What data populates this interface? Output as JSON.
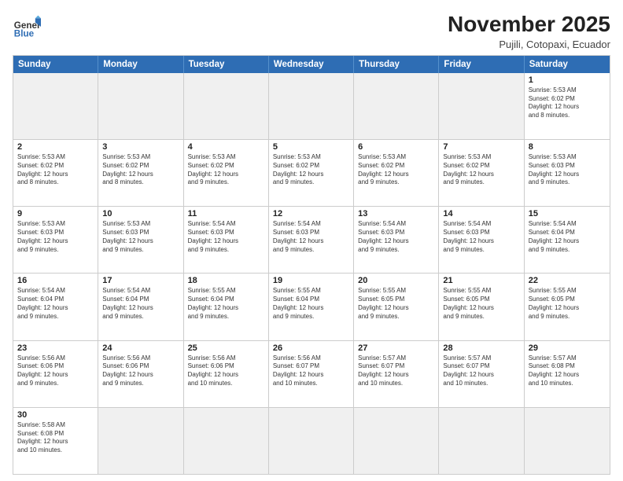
{
  "logo": {
    "line1": "General",
    "line2": "Blue"
  },
  "title": "November 2025",
  "subtitle": "Pujili, Cotopaxi, Ecuador",
  "days_of_week": [
    "Sunday",
    "Monday",
    "Tuesday",
    "Wednesday",
    "Thursday",
    "Friday",
    "Saturday"
  ],
  "weeks": [
    [
      {
        "day": "",
        "empty": true
      },
      {
        "day": "",
        "empty": true
      },
      {
        "day": "",
        "empty": true
      },
      {
        "day": "",
        "empty": true
      },
      {
        "day": "",
        "empty": true
      },
      {
        "day": "",
        "empty": true
      },
      {
        "day": "1",
        "info": "Sunrise: 5:53 AM\nSunset: 6:02 PM\nDaylight: 12 hours\nand 8 minutes."
      }
    ],
    [
      {
        "day": "2",
        "info": "Sunrise: 5:53 AM\nSunset: 6:02 PM\nDaylight: 12 hours\nand 8 minutes."
      },
      {
        "day": "3",
        "info": "Sunrise: 5:53 AM\nSunset: 6:02 PM\nDaylight: 12 hours\nand 8 minutes."
      },
      {
        "day": "4",
        "info": "Sunrise: 5:53 AM\nSunset: 6:02 PM\nDaylight: 12 hours\nand 9 minutes."
      },
      {
        "day": "5",
        "info": "Sunrise: 5:53 AM\nSunset: 6:02 PM\nDaylight: 12 hours\nand 9 minutes."
      },
      {
        "day": "6",
        "info": "Sunrise: 5:53 AM\nSunset: 6:02 PM\nDaylight: 12 hours\nand 9 minutes."
      },
      {
        "day": "7",
        "info": "Sunrise: 5:53 AM\nSunset: 6:02 PM\nDaylight: 12 hours\nand 9 minutes."
      },
      {
        "day": "8",
        "info": "Sunrise: 5:53 AM\nSunset: 6:03 PM\nDaylight: 12 hours\nand 9 minutes."
      }
    ],
    [
      {
        "day": "9",
        "info": "Sunrise: 5:53 AM\nSunset: 6:03 PM\nDaylight: 12 hours\nand 9 minutes."
      },
      {
        "day": "10",
        "info": "Sunrise: 5:53 AM\nSunset: 6:03 PM\nDaylight: 12 hours\nand 9 minutes."
      },
      {
        "day": "11",
        "info": "Sunrise: 5:54 AM\nSunset: 6:03 PM\nDaylight: 12 hours\nand 9 minutes."
      },
      {
        "day": "12",
        "info": "Sunrise: 5:54 AM\nSunset: 6:03 PM\nDaylight: 12 hours\nand 9 minutes."
      },
      {
        "day": "13",
        "info": "Sunrise: 5:54 AM\nSunset: 6:03 PM\nDaylight: 12 hours\nand 9 minutes."
      },
      {
        "day": "14",
        "info": "Sunrise: 5:54 AM\nSunset: 6:03 PM\nDaylight: 12 hours\nand 9 minutes."
      },
      {
        "day": "15",
        "info": "Sunrise: 5:54 AM\nSunset: 6:04 PM\nDaylight: 12 hours\nand 9 minutes."
      }
    ],
    [
      {
        "day": "16",
        "info": "Sunrise: 5:54 AM\nSunset: 6:04 PM\nDaylight: 12 hours\nand 9 minutes."
      },
      {
        "day": "17",
        "info": "Sunrise: 5:54 AM\nSunset: 6:04 PM\nDaylight: 12 hours\nand 9 minutes."
      },
      {
        "day": "18",
        "info": "Sunrise: 5:55 AM\nSunset: 6:04 PM\nDaylight: 12 hours\nand 9 minutes."
      },
      {
        "day": "19",
        "info": "Sunrise: 5:55 AM\nSunset: 6:04 PM\nDaylight: 12 hours\nand 9 minutes."
      },
      {
        "day": "20",
        "info": "Sunrise: 5:55 AM\nSunset: 6:05 PM\nDaylight: 12 hours\nand 9 minutes."
      },
      {
        "day": "21",
        "info": "Sunrise: 5:55 AM\nSunset: 6:05 PM\nDaylight: 12 hours\nand 9 minutes."
      },
      {
        "day": "22",
        "info": "Sunrise: 5:55 AM\nSunset: 6:05 PM\nDaylight: 12 hours\nand 9 minutes."
      }
    ],
    [
      {
        "day": "23",
        "info": "Sunrise: 5:56 AM\nSunset: 6:06 PM\nDaylight: 12 hours\nand 9 minutes."
      },
      {
        "day": "24",
        "info": "Sunrise: 5:56 AM\nSunset: 6:06 PM\nDaylight: 12 hours\nand 9 minutes."
      },
      {
        "day": "25",
        "info": "Sunrise: 5:56 AM\nSunset: 6:06 PM\nDaylight: 12 hours\nand 10 minutes."
      },
      {
        "day": "26",
        "info": "Sunrise: 5:56 AM\nSunset: 6:07 PM\nDaylight: 12 hours\nand 10 minutes."
      },
      {
        "day": "27",
        "info": "Sunrise: 5:57 AM\nSunset: 6:07 PM\nDaylight: 12 hours\nand 10 minutes."
      },
      {
        "day": "28",
        "info": "Sunrise: 5:57 AM\nSunset: 6:07 PM\nDaylight: 12 hours\nand 10 minutes."
      },
      {
        "day": "29",
        "info": "Sunrise: 5:57 AM\nSunset: 6:08 PM\nDaylight: 12 hours\nand 10 minutes."
      }
    ],
    [
      {
        "day": "30",
        "info": "Sunrise: 5:58 AM\nSunset: 6:08 PM\nDaylight: 12 hours\nand 10 minutes."
      },
      {
        "day": "",
        "empty": true
      },
      {
        "day": "",
        "empty": true
      },
      {
        "day": "",
        "empty": true
      },
      {
        "day": "",
        "empty": true
      },
      {
        "day": "",
        "empty": true
      },
      {
        "day": "",
        "empty": true
      }
    ]
  ]
}
